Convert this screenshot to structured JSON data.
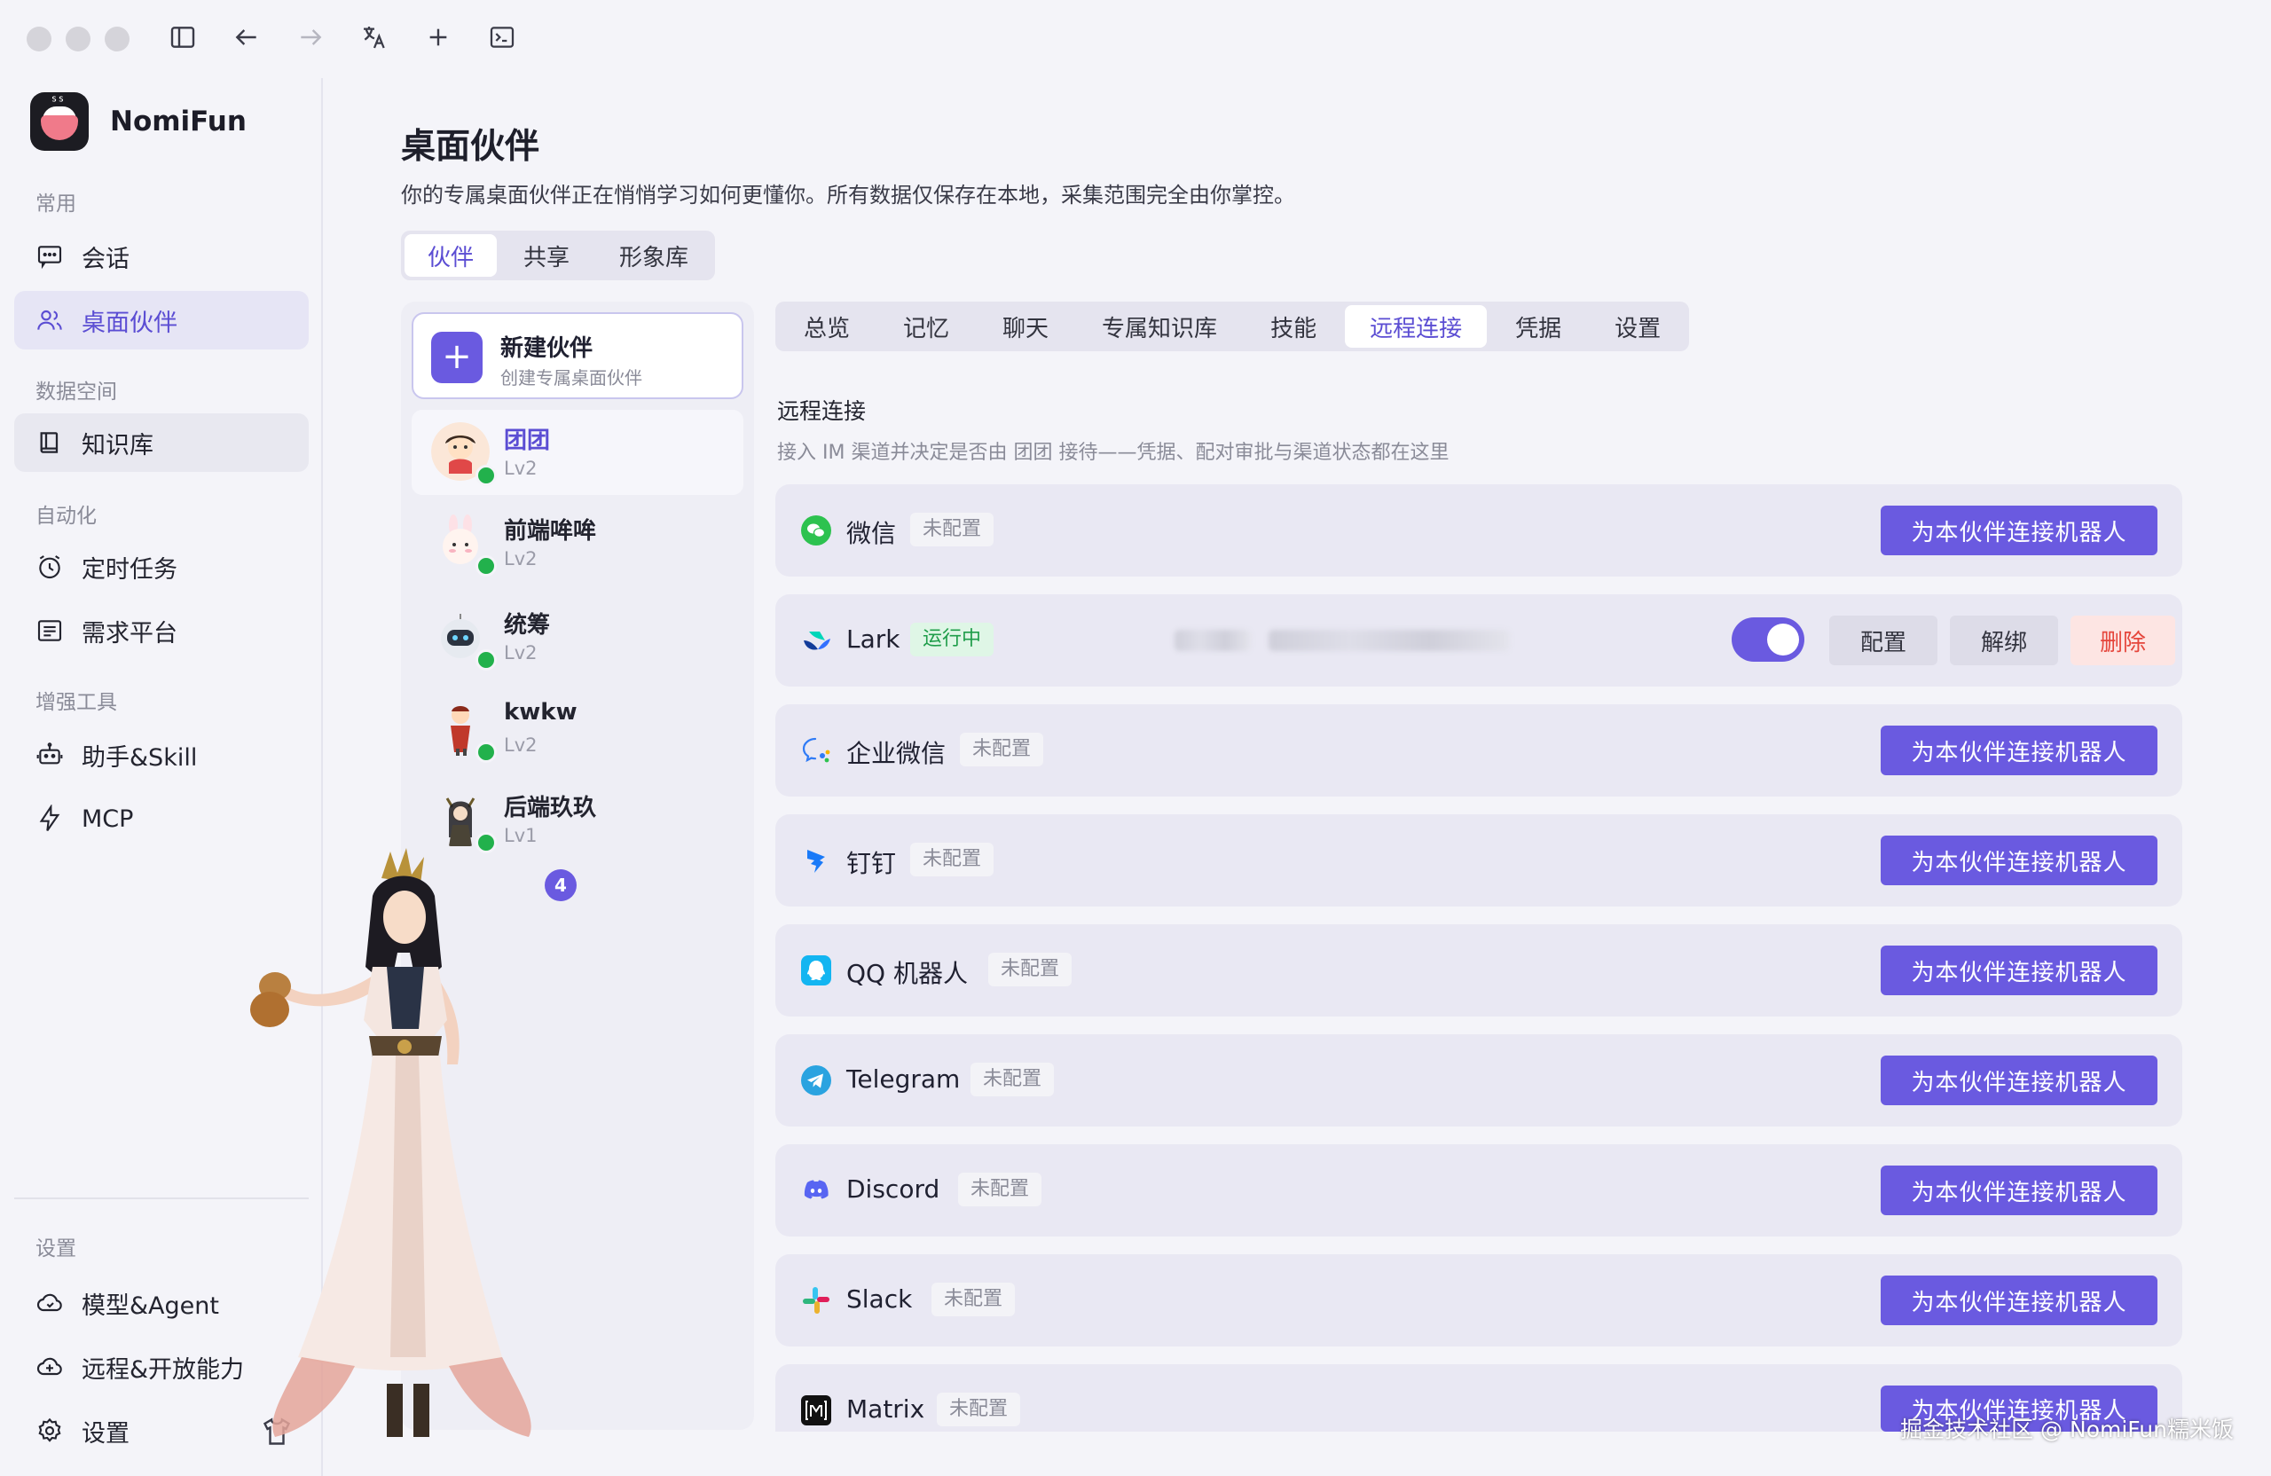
{
  "app": {
    "name": "NomiFun"
  },
  "sidebar": {
    "sections": {
      "common": "常用",
      "data": "数据空间",
      "automation": "自动化",
      "tools": "增强工具",
      "settings": "设置"
    },
    "items": {
      "chat": "会话",
      "companion": "桌面伙伴",
      "knowledge": "知识库",
      "schedule": "定时任务",
      "requirements": "需求平台",
      "skills": "助手&Skill",
      "mcp": "MCP",
      "models": "模型&Agent",
      "remote": "远程&开放能力",
      "settings": "设置"
    }
  },
  "main": {
    "title": "桌面伙伴",
    "description": "你的专属桌面伙伴正在悄悄学习如何更懂你。所有数据仅保存在本地，采集范围完全由你掌控。",
    "tabs": [
      "伙伴",
      "共享",
      "形象库"
    ]
  },
  "companions": {
    "new_title": "新建伙伴",
    "new_subtitle": "创建专属桌面伙伴",
    "list": [
      {
        "name": "团团",
        "level": "Lv2"
      },
      {
        "name": "前端哞哞",
        "level": "Lv2"
      },
      {
        "name": "统筹",
        "level": "Lv2"
      },
      {
        "name": "kwkw",
        "level": "Lv2"
      },
      {
        "name": "后端玖玖",
        "level": "Lv1"
      }
    ],
    "count_badge": "4"
  },
  "detail": {
    "tabs": [
      "总览",
      "记忆",
      "聊天",
      "专属知识库",
      "技能",
      "远程连接",
      "凭据",
      "设置"
    ],
    "section_title": "远程连接",
    "section_desc": "接入 IM 渠道并决定是否由 团团 接待——凭据、配对审批与渠道状态都在这里",
    "connect_label": "为本伙伴连接机器人",
    "status_unconfigured": "未配置",
    "status_running": "运行中",
    "config_label": "配置",
    "unbind_label": "解绑",
    "delete_label": "删除",
    "channels": [
      "微信",
      "Lark",
      "企业微信",
      "钉钉",
      "QQ 机器人",
      "Telegram",
      "Discord",
      "Slack",
      "Matrix"
    ]
  },
  "colors": {
    "accent": "#6a5ae0",
    "success": "#22b14c",
    "danger": "#e5463c"
  },
  "watermark": "掘金技术社区 @ NomiFun糯米饭"
}
